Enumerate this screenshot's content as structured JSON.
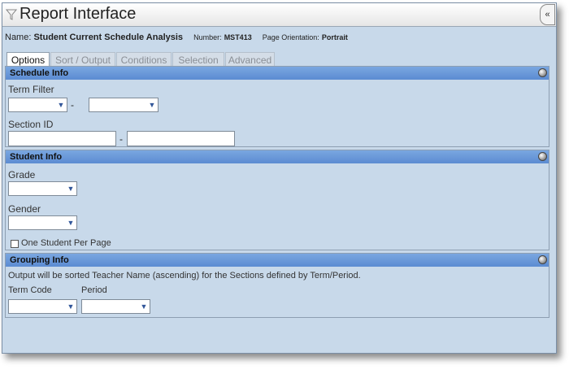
{
  "window": {
    "title": "Report Interface",
    "collapse_label": "«"
  },
  "report": {
    "name_label": "Name:",
    "name": "Student Current Schedule Analysis",
    "number_label": "Number:",
    "number": "MST413",
    "orientation_label": "Page Orientation:",
    "orientation": "Portrait"
  },
  "tabs": [
    {
      "label": "Options",
      "active": true
    },
    {
      "label": "Sort / Output",
      "active": false
    },
    {
      "label": "Conditions",
      "active": false
    },
    {
      "label": "Selection",
      "active": false
    },
    {
      "label": "Advanced",
      "active": false
    }
  ],
  "schedule_info": {
    "header": "Schedule Info",
    "term_filter_label": "Term Filter",
    "term_filter_from": "",
    "term_filter_to": "",
    "range_dash": "-",
    "section_id_label": "Section ID",
    "section_id_from": "",
    "section_id_to": ""
  },
  "student_info": {
    "header": "Student Info",
    "grade_label": "Grade",
    "grade_value": "",
    "gender_label": "Gender",
    "gender_value": "",
    "one_student_label": "One Student Per Page",
    "one_student_checked": false
  },
  "grouping_info": {
    "header": "Grouping Info",
    "note": "Output will be sorted Teacher Name (ascending) for the Sections defined by Term/Period.",
    "term_code_label": "Term Code",
    "term_code_value": "",
    "period_label": "Period",
    "period_value": ""
  }
}
